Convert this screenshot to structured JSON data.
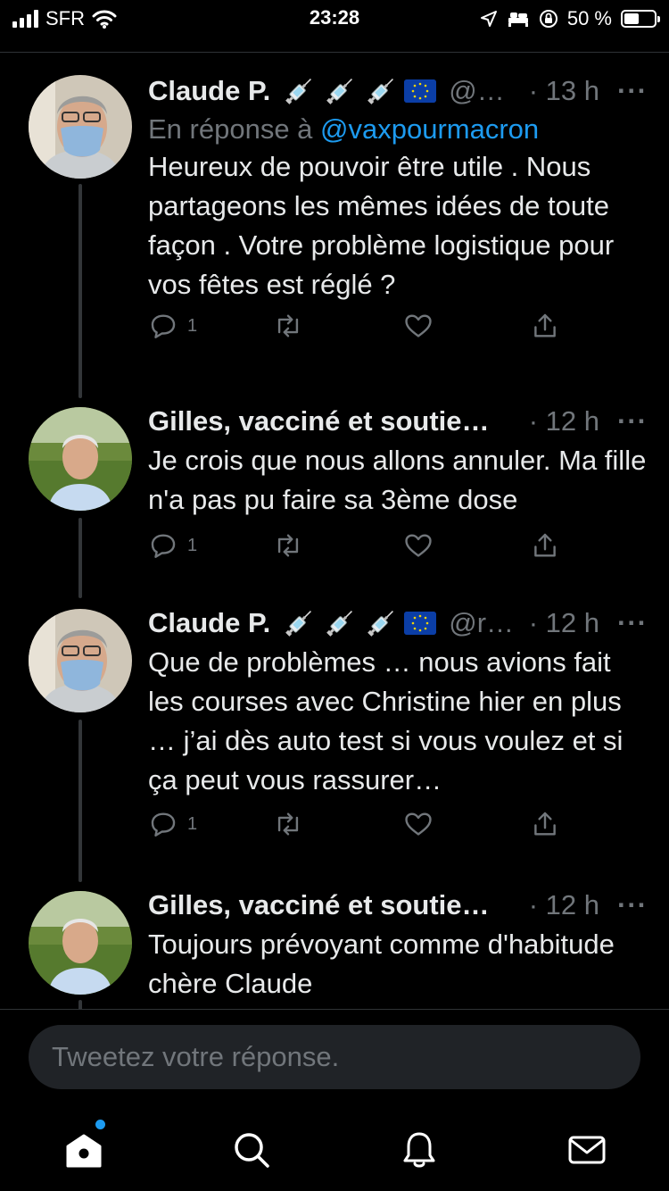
{
  "status_bar": {
    "carrier": "SFR",
    "time": "23:28",
    "battery": "50 %",
    "battery_level": 0.5
  },
  "colors": {
    "background": "#000000",
    "accent": "#1d9bf0",
    "text": "#e7e9ea",
    "secondary": "#71767b"
  },
  "tweets": [
    {
      "name": "Claude P.",
      "emojis": [
        "syringe-icon",
        "syringe-icon",
        "syringe-icon",
        "eu-flag-icon"
      ],
      "handle": "@…",
      "time": "· 13 h",
      "more": "···",
      "reply_prefix": "En réponse à ",
      "reply_mention": "@vaxpourmacron",
      "text": "Heureux de pouvoir être utile . Nous partageons les mêmes idées de toute façon . Votre problème logistique pour vos fêtes est réglé ?",
      "reply_count": "1"
    },
    {
      "name": "Gilles, vacciné et soutie…",
      "time": "· 12 h",
      "more": "···",
      "text": "Je crois que nous allons annuler. Ma fille n'a pas pu faire sa 3ème dose",
      "reply_count": "1"
    },
    {
      "name": "Claude P.",
      "emojis": [
        "syringe-icon",
        "syringe-icon",
        "syringe-icon",
        "eu-flag-icon"
      ],
      "handle": "@r…",
      "time": "· 12 h",
      "more": "···",
      "text": "Que de problèmes … nous avions fait les courses avec Christine hier en plus … j’ai dès auto test si vous voulez et si ça peut vous rassurer…",
      "reply_count": "1"
    },
    {
      "name": "Gilles, vacciné et soutie…",
      "time": "· 12 h",
      "more": "···",
      "text": "Toujours prévoyant comme d'habitude chère Claude"
    }
  ],
  "reply_box": {
    "placeholder": "Tweetez votre réponse."
  },
  "tabbar": {
    "items": [
      "home-icon",
      "search-icon",
      "bell-icon",
      "mail-icon"
    ]
  }
}
